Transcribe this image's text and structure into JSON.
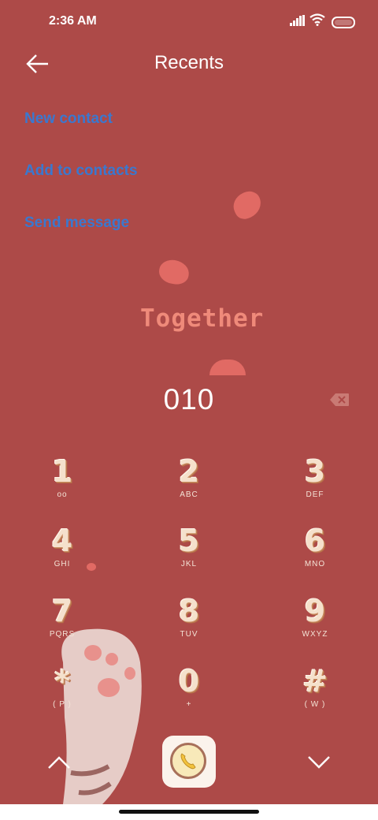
{
  "status_bar": {
    "time": "2:36 AM"
  },
  "header": {
    "title": "Recents"
  },
  "actions": [
    "New contact",
    "Add to contacts",
    "Send message"
  ],
  "wallpaper": {
    "text": "Together"
  },
  "dialer": {
    "number": "010"
  },
  "keypad": [
    {
      "digit": "1",
      "letters": "oo"
    },
    {
      "digit": "2",
      "letters": "ABC"
    },
    {
      "digit": "3",
      "letters": "DEF"
    },
    {
      "digit": "4",
      "letters": "GHI"
    },
    {
      "digit": "5",
      "letters": "JKL"
    },
    {
      "digit": "6",
      "letters": "MNO"
    },
    {
      "digit": "7",
      "letters": "PQRS"
    },
    {
      "digit": "8",
      "letters": "TUV"
    },
    {
      "digit": "9",
      "letters": "WXYZ"
    },
    {
      "digit": "*",
      "letters": "( P )"
    },
    {
      "digit": "0",
      "letters": "+"
    },
    {
      "digit": "#",
      "letters": "( W )"
    }
  ],
  "colors": {
    "background": "#ad4a48",
    "link": "#3a78cf",
    "accent": "#e16a64"
  },
  "icons": [
    "back-arrow-icon",
    "backspace-icon",
    "chevron-up-icon",
    "chevron-down-icon",
    "phone-icon"
  ]
}
